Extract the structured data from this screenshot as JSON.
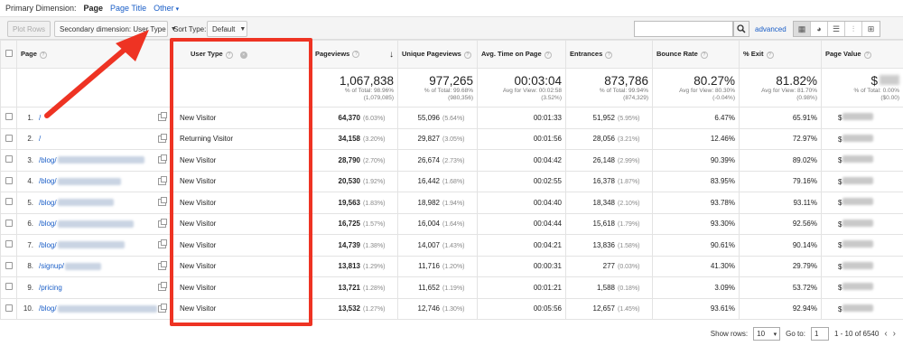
{
  "dimension_bar": {
    "label": "Primary Dimension:",
    "options": [
      "Page",
      "Page Title",
      "Other"
    ]
  },
  "toolbar": {
    "plot_rows": "Plot Rows",
    "secondary_dimension": "Secondary dimension: User Type",
    "sort_type_label": "Sort Type:",
    "sort_type_value": "Default",
    "search_placeholder": "",
    "advanced": "advanced",
    "view_icons": [
      "table-icon",
      "pie-icon",
      "performance-icon",
      "comparison-icon",
      "pivot-icon"
    ]
  },
  "columns": [
    "Page",
    "User Type",
    "Pageviews",
    "Unique Pageviews",
    "Avg. Time on Page",
    "Entrances",
    "Bounce Rate",
    "% Exit",
    "Page Value"
  ],
  "totals": {
    "pageviews": {
      "value": "1,067,838",
      "line1": "% of Total: 98.96%",
      "line2": "(1,079,085)"
    },
    "unique": {
      "value": "977,265",
      "line1": "% of Total: 99.68%",
      "line2": "(980,356)"
    },
    "avgtime": {
      "value": "00:03:04",
      "line1": "Avg for View: 00:02:58",
      "line2": "(3.52%)"
    },
    "entrances": {
      "value": "873,786",
      "line1": "% of Total: 99.94%",
      "line2": "(874,329)"
    },
    "bounce": {
      "value": "80.27%",
      "line1": "Avg for View: 80.30%",
      "line2": "(-0.04%)"
    },
    "exit": {
      "value": "81.82%",
      "line1": "Avg for View: 81.70%",
      "line2": "(0.98%)"
    },
    "pagevalue": {
      "value": "$",
      "line1": "% of Total: 0.00%",
      "line2": "($0.00)"
    }
  },
  "rows": [
    {
      "n": "1.",
      "page": "/",
      "user": "New Visitor",
      "pv": "64,370",
      "pvp": "(6.03%)",
      "upv": "55,096",
      "upvp": "(5.64%)",
      "time": "00:01:33",
      "ent": "51,952",
      "entp": "(5.95%)",
      "bounce": "6.47%",
      "exit": "65.91%",
      "val": "$"
    },
    {
      "n": "2.",
      "page": "/",
      "user": "Returning Visitor",
      "pv": "34,158",
      "pvp": "(3.20%)",
      "upv": "29,827",
      "upvp": "(3.05%)",
      "time": "00:01:56",
      "ent": "28,056",
      "entp": "(3.21%)",
      "bounce": "12.46%",
      "exit": "72.97%",
      "val": "$"
    },
    {
      "n": "3.",
      "page": "/blog/",
      "user": "New Visitor",
      "pv": "28,790",
      "pvp": "(2.70%)",
      "upv": "26,674",
      "upvp": "(2.73%)",
      "time": "00:04:42",
      "ent": "26,148",
      "entp": "(2.99%)",
      "bounce": "90.39%",
      "exit": "89.02%",
      "val": "$"
    },
    {
      "n": "4.",
      "page": "/blog/",
      "user": "New Visitor",
      "pv": "20,530",
      "pvp": "(1.92%)",
      "upv": "16,442",
      "upvp": "(1.68%)",
      "time": "00:02:55",
      "ent": "16,378",
      "entp": "(1.87%)",
      "bounce": "83.95%",
      "exit": "79.16%",
      "val": "$"
    },
    {
      "n": "5.",
      "page": "/blog/",
      "user": "New Visitor",
      "pv": "19,563",
      "pvp": "(1.83%)",
      "upv": "18,982",
      "upvp": "(1.94%)",
      "time": "00:04:40",
      "ent": "18,348",
      "entp": "(2.10%)",
      "bounce": "93.78%",
      "exit": "93.11%",
      "val": "$"
    },
    {
      "n": "6.",
      "page": "/blog/",
      "user": "New Visitor",
      "pv": "16,725",
      "pvp": "(1.57%)",
      "upv": "16,004",
      "upvp": "(1.64%)",
      "time": "00:04:44",
      "ent": "15,618",
      "entp": "(1.79%)",
      "bounce": "93.30%",
      "exit": "92.56%",
      "val": "$"
    },
    {
      "n": "7.",
      "page": "/blog/",
      "user": "New Visitor",
      "pv": "14,739",
      "pvp": "(1.38%)",
      "upv": "14,007",
      "upvp": "(1.43%)",
      "time": "00:04:21",
      "ent": "13,836",
      "entp": "(1.58%)",
      "bounce": "90.61%",
      "exit": "90.14%",
      "val": "$"
    },
    {
      "n": "8.",
      "page": "/signup/",
      "user": "New Visitor",
      "pv": "13,813",
      "pvp": "(1.29%)",
      "upv": "11,716",
      "upvp": "(1.20%)",
      "time": "00:00:31",
      "ent": "277",
      "entp": "(0.03%)",
      "bounce": "41.30%",
      "exit": "29.79%",
      "val": "$"
    },
    {
      "n": "9.",
      "page": "/pricing",
      "user": "New Visitor",
      "pv": "13,721",
      "pvp": "(1.28%)",
      "upv": "11,652",
      "upvp": "(1.19%)",
      "time": "00:01:21",
      "ent": "1,588",
      "entp": "(0.18%)",
      "bounce": "3.09%",
      "exit": "53.72%",
      "val": "$"
    },
    {
      "n": "10.",
      "page": "/blog/",
      "user": "New Visitor",
      "pv": "13,532",
      "pvp": "(1.27%)",
      "upv": "12,746",
      "upvp": "(1.30%)",
      "time": "00:05:56",
      "ent": "12,657",
      "entp": "(1.45%)",
      "bounce": "93.61%",
      "exit": "92.94%",
      "val": "$"
    }
  ],
  "footer": {
    "show_rows_label": "Show rows:",
    "show_rows_value": "10",
    "goto_label": "Go to:",
    "goto_value": "1",
    "range": "1 - 10 of 6540"
  },
  "colors": {
    "accent": "#1a5ec7",
    "highlight": "#ee3323"
  }
}
